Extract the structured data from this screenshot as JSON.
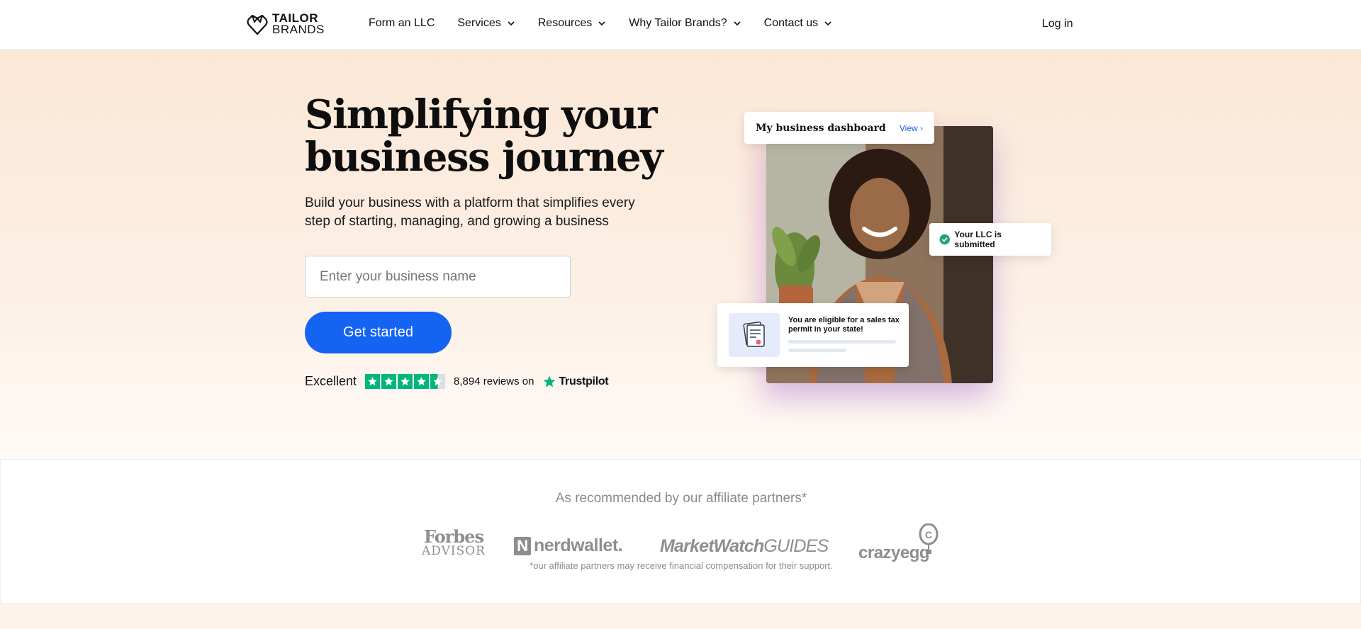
{
  "nav": {
    "logo_line1": "TAILOR",
    "logo_line2": "BRANDS",
    "items": [
      {
        "label": "Form an LLC",
        "has_dropdown": false
      },
      {
        "label": "Services",
        "has_dropdown": true
      },
      {
        "label": "Resources",
        "has_dropdown": true
      },
      {
        "label": "Why Tailor Brands?",
        "has_dropdown": true
      },
      {
        "label": "Contact us",
        "has_dropdown": true
      }
    ],
    "login": "Log in"
  },
  "hero": {
    "headline": "Simplifying your business journey",
    "subtitle": "Build your business with a platform that simplifies every step of starting, managing, and growing a business",
    "input_placeholder": "Enter your business name",
    "input_value": "",
    "cta": "Get started",
    "trust": {
      "rating_word": "Excellent",
      "stars": 4.5,
      "reviews": "8,894 reviews on",
      "brand": "Trustpilot"
    }
  },
  "visual": {
    "dashboard_title": "My business dashboard",
    "dashboard_link": "View",
    "llc_status": "Your LLC is submitted",
    "tax_notice": "You are eligible for a sales tax permit in your state!"
  },
  "partners": {
    "title": "As recommended by our affiliate partners*",
    "logos": {
      "forbes_line1": "Forbes",
      "forbes_line2": "ADVISOR",
      "nerdwallet": "nerdwallet.",
      "marketwatch_bold": "MarketWatch",
      "marketwatch_rest": "GUIDES",
      "crazyegg": "crazyegg"
    },
    "note": "*our affiliate partners may receive financial compensation for their support."
  },
  "colors": {
    "brand_blue": "#1463f3",
    "trustpilot_green": "#00b67a",
    "success_green": "#1ea672",
    "hero_bg": "#fbe7d6"
  }
}
